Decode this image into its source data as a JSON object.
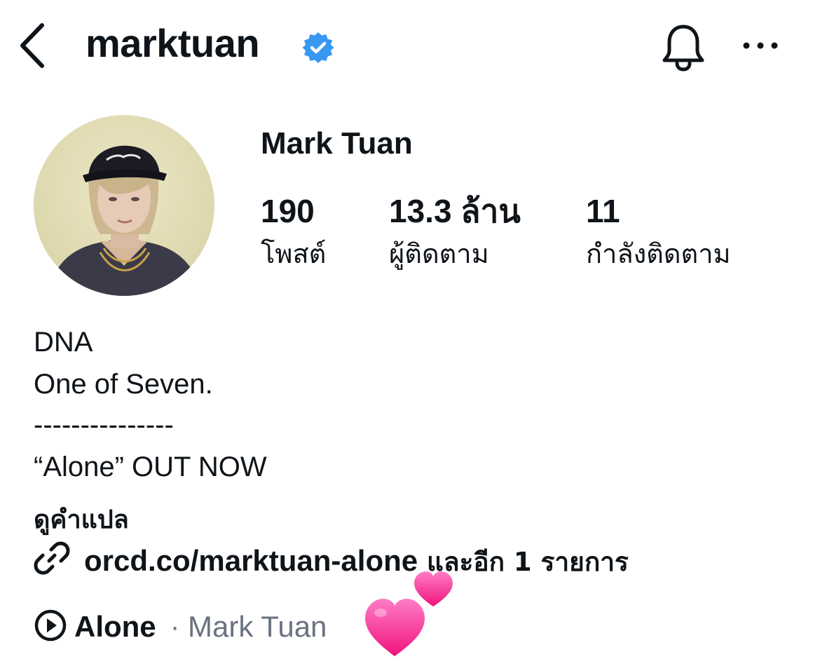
{
  "header": {
    "username": "marktuan",
    "back_icon": "chevron-left-icon",
    "verified_icon": "verified-badge-icon",
    "bell_icon": "bell-icon",
    "more_icon": "more-horizontal-icon"
  },
  "profile": {
    "display_name": "Mark Tuan",
    "avatar_icon": "profile-photo"
  },
  "stats": [
    {
      "value": "190",
      "label": "โพสต์"
    },
    {
      "value": "13.3 ล้าน",
      "label": "ผู้ติดตาม"
    },
    {
      "value": "11",
      "label": "กำลังติดตาม"
    }
  ],
  "bio": {
    "line1": "DNA",
    "line2": "One of Seven.",
    "line3": "---------------",
    "line4": "“Alone” OUT NOW",
    "translate_label": "ดูคำแปล"
  },
  "link": {
    "url": "orcd.co/marktuan-alone",
    "more": " และอีก 1 รายการ",
    "icon": "link-icon"
  },
  "music": {
    "title": "Alone",
    "separator": "·",
    "artist": "Mark Tuan",
    "icon": "play-circle-icon"
  },
  "decoration": {
    "icon": "two-hearts-emoji",
    "color": "#ff4fa3"
  },
  "colors": {
    "verified": "#3897f0",
    "text": "#0f1419",
    "muted": "#6b7280"
  }
}
